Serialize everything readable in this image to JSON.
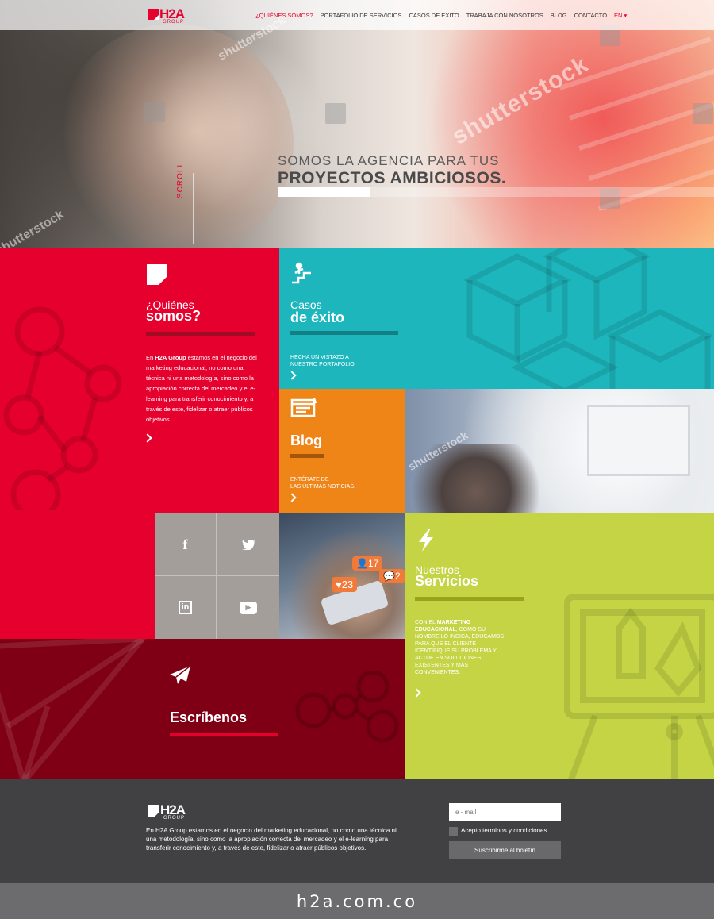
{
  "nav": {
    "logo_text": "H2A",
    "logo_sub": "GROUP",
    "items": [
      "¿QUIÉNES SOMOS?",
      "PORTAFOLIO DE SERVICIOS",
      "CASOS DE EXITO",
      "TRABAJA CON NOSOTROS",
      "BLOG",
      "CONTACTO"
    ],
    "lang": "EN ▾"
  },
  "hero": {
    "line1": "SOMOS LA AGENCIA PARA TUS",
    "line2": "PROYECTOS AMBICIOSOS.",
    "scroll_label": "SCROLL",
    "progress": 0.21,
    "watermark": "shutterstock"
  },
  "about": {
    "title1": "¿Quiénes",
    "title2": "somos?",
    "body_prefix": "En ",
    "body_brand": "H2A Group",
    "body_rest": " estamos en el negocio del marketing educacional, no como una técnica ni una metodología, sino como la apropiación correcta del mercadeo y el e-learning para transferir conocimiento y, a través de este, fidelizar o atraer públicos objetivos."
  },
  "cases": {
    "title1": "Casos",
    "title2": "de éxito",
    "small": "HECHA UN VISTAZO A\nNUESTRO PORTAFOLIO."
  },
  "blog": {
    "title": "Blog",
    "small": "ENTÉRATE DE\nLAS ÚLTIMAS NOTICIAS."
  },
  "social": {
    "facebook": "f",
    "twitter": "🐦",
    "linkedin": "in",
    "youtube": "▶"
  },
  "photo2": {
    "likes": "23",
    "followers": "17",
    "comments": "2"
  },
  "services": {
    "title1": "Nuestros",
    "title2": "Servicios",
    "body_prefix": "CON EL ",
    "body_brand": "MARKETING EDUCACIONAL",
    "body_rest": ", COMO SU NOMBRE LO INDICA, EDUCAMOS PARA QUE EL CLIENTE IDENTIFIQUE SU PROBLEMA Y ACTÚE EN SOLUCIONES EXISTENTES Y MÁS CONVENIENTES."
  },
  "contact": {
    "title": "Escríbenos"
  },
  "footer": {
    "logo_text": "H2A",
    "logo_sub": "GROUP",
    "text": "En H2A Group estamos en el negocio del marketing educacional, no como una técnica ni una metodología, sino como la apropiación correcta del mercadeo y el e-learning para transferir conocimiento y, a través de este, fidelizar o atraer públicos objetivos.",
    "email_placeholder": "e - mail",
    "terms": "Acepto terminos y condiciones",
    "subscribe": "Suscribirme al boletín"
  },
  "domain": "h2a.com.co",
  "colors": {
    "red": "#e6002d",
    "teal": "#1eb6bd",
    "orange": "#ef8417",
    "lime": "#c5d445",
    "dark_red": "#7f0014",
    "footer": "#414042"
  }
}
